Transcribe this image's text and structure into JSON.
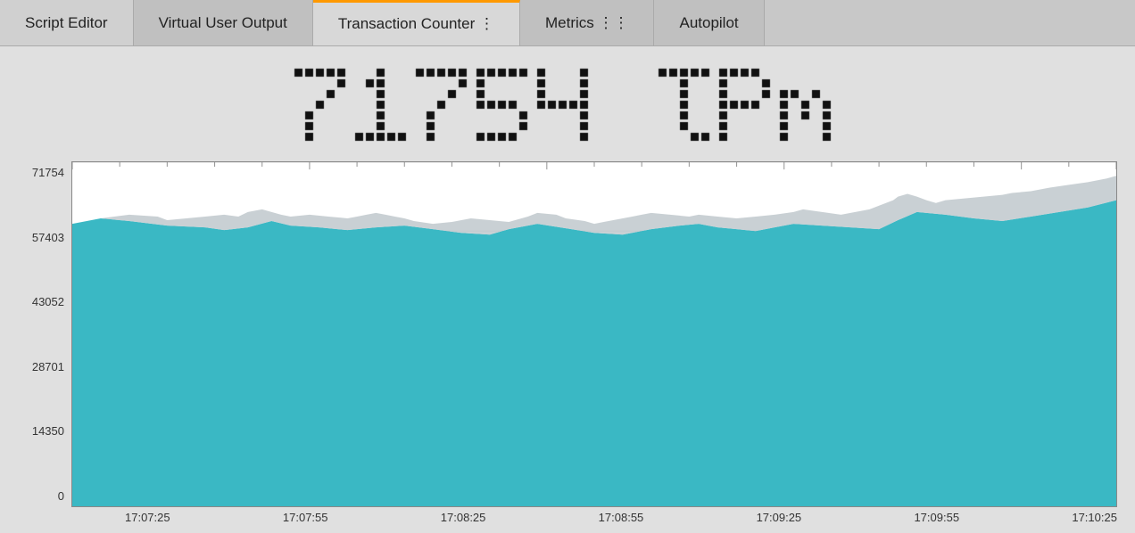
{
  "tabs": [
    {
      "label": "Script Editor",
      "active": false
    },
    {
      "label": "Virtual User Output",
      "active": false
    },
    {
      "label": "Transaction Counter ⋮",
      "active": true
    },
    {
      "label": "Metrics ⋮⋮",
      "active": false
    },
    {
      "label": "Autopilot",
      "active": false
    }
  ],
  "counter": {
    "value": "71754",
    "unit": "tpm"
  },
  "chart": {
    "y_labels": [
      "71754",
      "57403",
      "43052",
      "28701",
      "14350",
      "0"
    ],
    "x_labels": [
      "17:07:25",
      "17:07:55",
      "17:08:25",
      "17:08:55",
      "17:09:25",
      "17:09:55",
      "17:10:25"
    ],
    "teal_color": "#3ab8c4",
    "gray_color": "#b0b8bc",
    "white_fill": "#f0f0f0"
  },
  "colors": {
    "tab_active_border": "#ff9900",
    "tab_bg": "#c0c0c0",
    "tab_active_bg": "#d8d8d8",
    "body_bg": "#e0e0e0"
  }
}
